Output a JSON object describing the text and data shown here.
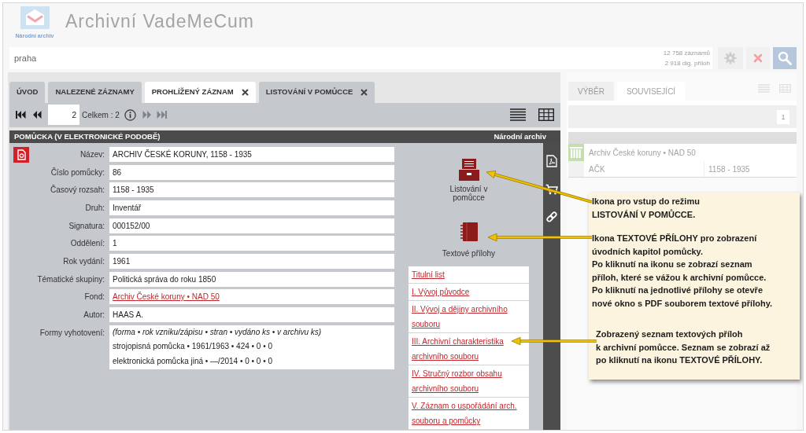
{
  "header": {
    "logo_caption": "Národní archiv",
    "title": "Archivní VadeMeCum"
  },
  "search": {
    "value": "praha",
    "records_count": "12 758 záznamů",
    "attachments_count": "2 918 dig. příloh"
  },
  "tabs": [
    {
      "label": "ÚVOD",
      "selected": false,
      "closable": false
    },
    {
      "label": "NALEZENÉ ZÁZNAMY",
      "selected": false,
      "closable": false
    },
    {
      "label": "PROHLÍŽENÝ ZÁZNAM",
      "selected": true,
      "closable": true
    },
    {
      "label": "LISTOVÁNÍ V POMŮCCE",
      "selected": false,
      "closable": true
    }
  ],
  "pager": {
    "page": "2",
    "total": "Celkem : 2",
    "back_disabled": false,
    "forward_disabled": true
  },
  "record": {
    "section_title": "POMŮCKA (V ELEKTRONICKÉ PODOBĚ)",
    "source": "Národní archiv",
    "fields": [
      {
        "label": "Název:",
        "kind": "text",
        "value": "ARCHIV ČESKÉ KORUNY, 1158 - 1935"
      },
      {
        "label": "Číslo pomůcky:",
        "kind": "text",
        "value": "86"
      },
      {
        "label": "Časový rozsah:",
        "kind": "text",
        "value": "1158 - 1935"
      },
      {
        "label": "Druh:",
        "kind": "text",
        "value": "Inventář"
      },
      {
        "label": "Signatura:",
        "kind": "text",
        "value": "000152/00"
      },
      {
        "label": "Oddělení:",
        "kind": "text",
        "value": "1"
      },
      {
        "label": "Rok vydání:",
        "kind": "text",
        "value": "1961"
      },
      {
        "label": "Tématické skupiny:",
        "kind": "text",
        "value": "Politická správa do roku 1850"
      },
      {
        "label": "Fond:",
        "kind": "link",
        "value": "Archiv České koruny • NAD 50"
      },
      {
        "label": "Autor:",
        "kind": "text",
        "value": "HAAS A."
      },
      {
        "label": "Formy vyhotovení:",
        "kind": "lines",
        "lines": [
          {
            "kind": "legend",
            "text": "(forma • rok vzniku/zápisu • stran • vydáno ks • v archivu ks)"
          },
          {
            "kind": "entry",
            "text": "strojopisná pomůcka • 1961/1963 • 424 • 0 • 0"
          },
          {
            "kind": "entry",
            "text": "elektronická pomůcka jiná • —/2014 • 0 • 0 • 0"
          }
        ]
      }
    ],
    "actions": [
      {
        "kind": "browse",
        "label": "Listování v pomůcce"
      },
      {
        "kind": "attachments",
        "label": "Textové přílohy"
      }
    ],
    "attachments": [
      "Titulní list",
      "I. Vývoj původce",
      "II. Vývoj a dějiny archivního souboru",
      "III. Archivní charakteristika archivního souboru",
      "IV. Stručný rozbor obsahu archivního souboru",
      "V. Záznam o uspořádání arch. souboru a pomůcky"
    ]
  },
  "related_panel": {
    "tabs": [
      {
        "label": "VÝBĚR",
        "selected": false
      },
      {
        "label": "SOUVISEJÍCÍ",
        "selected": true
      }
    ],
    "page": "1",
    "items": [
      {
        "title": "Archiv České koruny • NAD 50",
        "code": "AČK",
        "date_range": "1158 - 1935"
      }
    ]
  },
  "annotations": [
    {
      "text": "Ikona pro vstup do režimu\nLISTOVÁNÍ V POMŮCCE."
    },
    {
      "text": "Ikona TEXTOVÉ PŘÍLOHY pro zobrazení\núvodních kapitol pomůcky.\nPo kliknutí na ikonu se zobrazí seznam\npříloh, které se vážou k archivní pomůcce.\nPo kliknutí na jednotlivé přílohy se otevře\nnové okno s PDF souborem textové přílohy."
    },
    {
      "text": "Zobrazený seznam textových příloh\nk archivní pomůcce. Seznam se zobrazí až\npo kliknutí na ikonu TEXTOVÉ PŘÍLOHY."
    }
  ]
}
